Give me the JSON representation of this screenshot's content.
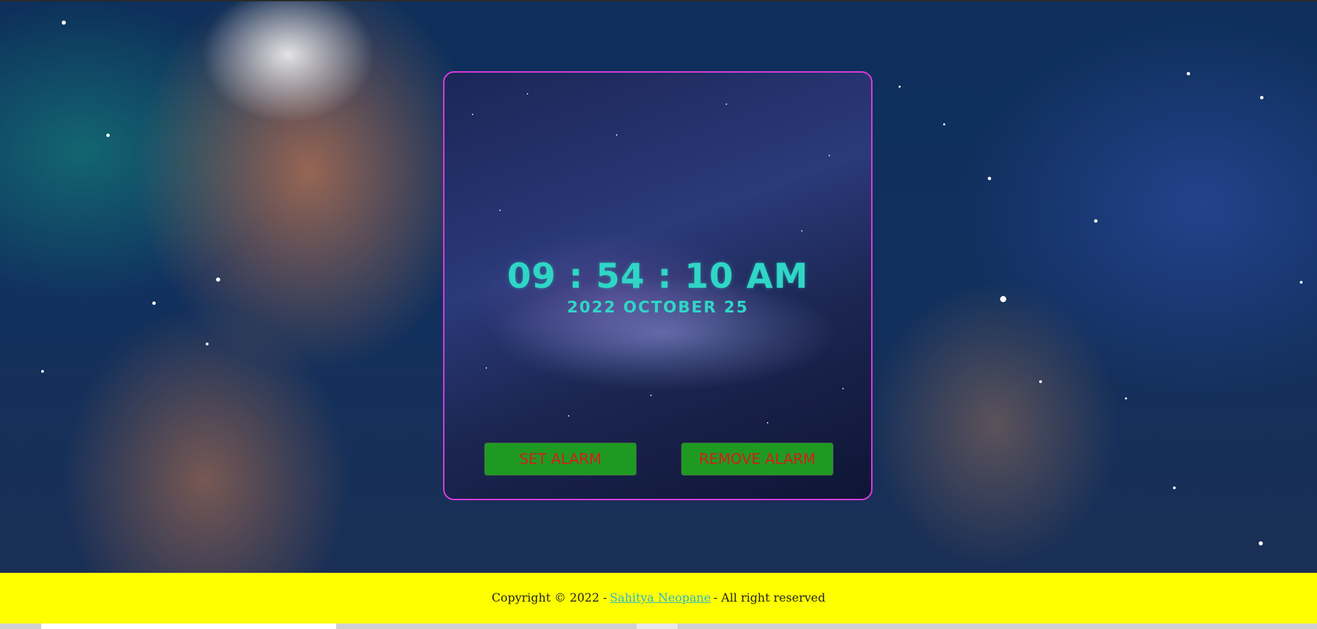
{
  "clock": {
    "time": "09 : 54 : 10 AM",
    "date": "2022 OCTOBER 25"
  },
  "buttons": {
    "set_alarm": "SET ALARM",
    "remove_alarm": "REMOVE ALARM"
  },
  "footer": {
    "prefix": "Copyright © 2022 -",
    "author_link": "Sahitya Neopane",
    "suffix": "- All right reserved"
  },
  "colors": {
    "clock_text": "#2fd6c6",
    "card_border": "#e03ce0",
    "button_bg": "#1e9a22",
    "button_text": "#d81b1b",
    "footer_bg": "#ffff00",
    "link": "#2fb8c8"
  }
}
